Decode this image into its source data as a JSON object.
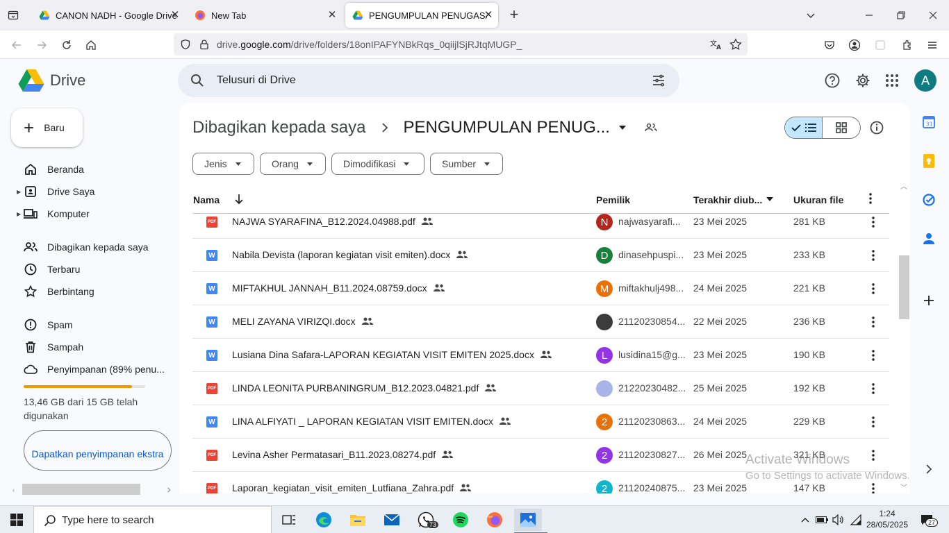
{
  "browser": {
    "tabs": [
      {
        "label": "CANON NADH - Google Drive",
        "active": false
      },
      {
        "label": "New Tab",
        "active": false
      },
      {
        "label": "PENGUMPULAN PENUGASAN \\",
        "active": true
      }
    ],
    "url_prefix": "drive.",
    "url_host": "google.com",
    "url_path": "/drive/folders/18onIPAFYNBkRqs_0qiijlSjRJtqMUGP_"
  },
  "drive": {
    "logo_text": "Drive",
    "search_placeholder": "Telusuri di Drive",
    "avatar_letter": "A"
  },
  "sidebar": {
    "new_label": "Baru",
    "items": [
      {
        "label": "Beranda",
        "icon": "home-icon"
      },
      {
        "label": "Drive Saya",
        "icon": "my-drive-icon"
      },
      {
        "label": "Komputer",
        "icon": "computer-icon"
      },
      {
        "label": "Dibagikan kepada saya",
        "icon": "shared-icon"
      },
      {
        "label": "Terbaru",
        "icon": "clock-icon"
      },
      {
        "label": "Berbintang",
        "icon": "star-icon"
      },
      {
        "label": "Spam",
        "icon": "spam-icon"
      },
      {
        "label": "Sampah",
        "icon": "trash-icon"
      },
      {
        "label": "Penyimpanan (89% penu...",
        "icon": "cloud-icon"
      }
    ],
    "storage_percent": 89,
    "storage_text": "13,46 GB dari 15 GB telah digunakan",
    "get_storage_label": "Dapatkan penyimpanan ekstra"
  },
  "main": {
    "breadcrumb_parent": "Dibagikan kepada saya",
    "breadcrumb_current": "PENGUMPULAN PENUG...",
    "filters": [
      "Jenis",
      "Orang",
      "Dimodifikasi",
      "Sumber"
    ],
    "columns": {
      "name": "Nama",
      "owner": "Pemilik",
      "modified": "Terakhir diub...",
      "size": "Ukuran file"
    },
    "files": [
      {
        "type": "PDF",
        "name": "NAJWA SYARAFINA_B12.2024.04988.pdf",
        "owner_initial": "N",
        "owner_color": "#b3261e",
        "owner": "najwasyarafi...",
        "date": "23 Mei 2025",
        "size": "281 KB"
      },
      {
        "type": "W",
        "name": "Nabila Devista (laporan kegiatan visit emiten).docx",
        "owner_initial": "D",
        "owner_color": "#188038",
        "owner": "dinasehpuspi...",
        "date": "23 Mei 2025",
        "size": "233 KB"
      },
      {
        "type": "W",
        "name": "MIFTAKHUL JANNAH_B11.2024.08759.docx",
        "owner_initial": "M",
        "owner_color": "#e8710a",
        "owner": "miftakhulj498...",
        "date": "24 Mei 2025",
        "size": "221 KB"
      },
      {
        "type": "W",
        "name": "MELI ZAYANA VIRIZQI.docx",
        "owner_initial": "",
        "owner_color": "#3c3c3c",
        "owner": "21120230854...",
        "date": "22 Mei 2025",
        "size": "236 KB"
      },
      {
        "type": "W",
        "name": "Lusiana Dina Safara-LAPORAN KEGIATAN VISIT EMITEN 2025.docx",
        "owner_initial": "L",
        "owner_color": "#9334e6",
        "owner": "lusidina15@g...",
        "date": "23 Mei 2025",
        "size": "190 KB"
      },
      {
        "type": "PDF",
        "name": "LINDA LEONITA PURBANINGRUM_B12.2023.04821.pdf",
        "owner_initial": "",
        "owner_color": "#a8b4e8",
        "owner": "21220230482...",
        "date": "25 Mei 2025",
        "size": "192 KB"
      },
      {
        "type": "W",
        "name": "LINA ALFIYATI _ LAPORAN KEGIATAN VISIT EMITEN.docx",
        "owner_initial": "2",
        "owner_color": "#e8710a",
        "owner": "21120230863...",
        "date": "24 Mei 2025",
        "size": "229 KB"
      },
      {
        "type": "PDF",
        "name": "Levina Asher Permatasari_B11.2023.08274.pdf",
        "owner_initial": "2",
        "owner_color": "#9334e6",
        "owner": "21120230827...",
        "date": "26 Mei 2025",
        "size": "321 KB"
      },
      {
        "type": "PDF",
        "name": "Laporan_kegiatan_visit_emiten_Lutfiana_Zahra.pdf",
        "owner_initial": "2",
        "owner_color": "#12b5cb",
        "owner": "21120240875...",
        "date": "23 Mei 2025",
        "size": "147 KB"
      }
    ]
  },
  "watermark": {
    "line1": "Activate Windows",
    "line2": "Go to Settings to activate Windows."
  },
  "taskbar": {
    "search_placeholder": "Type here to search",
    "whatsapp_badge": "73",
    "time": "1:24",
    "date": "28/05/2025",
    "notification_count": "27"
  },
  "colors": {
    "pdf": "#ea4335",
    "word": "#4285f4",
    "accent": "#0b57d0",
    "storage": "#f29900"
  }
}
